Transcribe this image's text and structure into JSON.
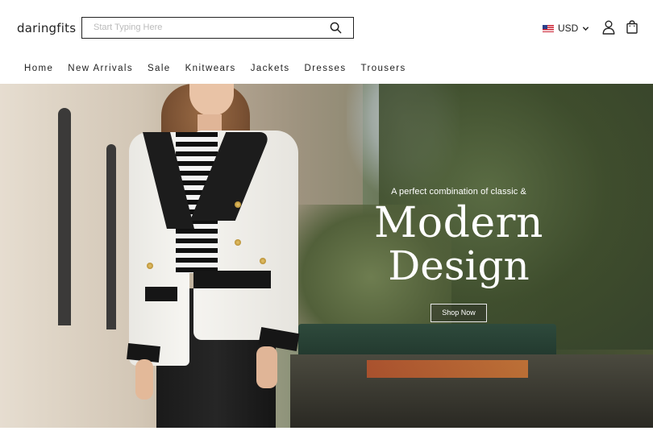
{
  "header": {
    "logo": "daringfits",
    "search": {
      "placeholder": "Start Typing Here",
      "value": ""
    },
    "currency": {
      "label": "USD"
    },
    "icons": {
      "search": "search-icon",
      "currency_dropdown": "chevron-down-icon",
      "account": "user-icon",
      "cart": "shopping-bag-icon",
      "flag": "us-flag-icon"
    }
  },
  "nav": {
    "items": [
      {
        "label": "Home"
      },
      {
        "label": "New Arrivals"
      },
      {
        "label": "Sale"
      },
      {
        "label": "Knitwears"
      },
      {
        "label": "Jackets"
      },
      {
        "label": "Dresses"
      },
      {
        "label": "Trousers"
      }
    ]
  },
  "hero": {
    "tagline": "A perfect combination of classic &",
    "heading_line1": "Modern",
    "heading_line2": "Design",
    "cta_label": "Shop Now"
  },
  "colors": {
    "text": "#222222",
    "background": "#ffffff",
    "hero_text": "#ffffff"
  }
}
